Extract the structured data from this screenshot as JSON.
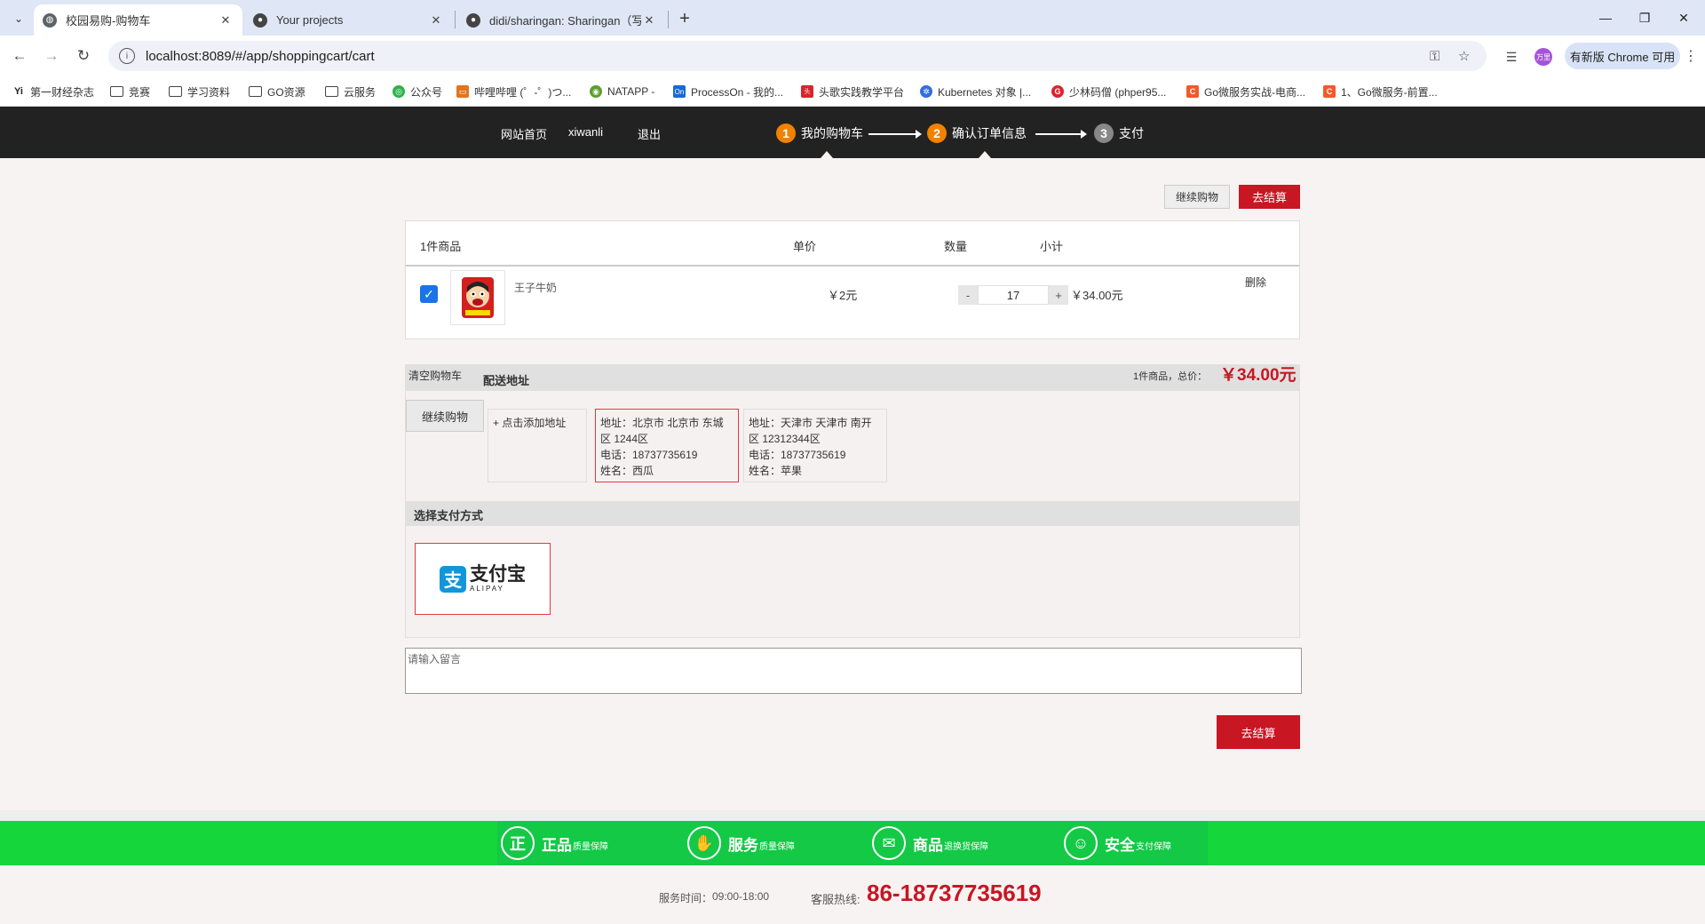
{
  "browser": {
    "tabs": [
      {
        "title": "校园易购-购物车",
        "active": true,
        "icon": "globe-icon"
      },
      {
        "title": "Your projects",
        "active": false,
        "icon": "github-icon"
      },
      {
        "title": "didi/sharingan: Sharingan（写",
        "active": false,
        "icon": "github-icon"
      }
    ],
    "url": "localhost:8089/#/app/shoppingcart/cart",
    "update_button": "有新版 Chrome 可用",
    "profile_label": "万里",
    "bookmarks": [
      {
        "label": "第一财经杂志",
        "icon": "yicai-icon",
        "color": "#222222"
      },
      {
        "label": "竞赛",
        "icon": "folder-icon",
        "color": ""
      },
      {
        "label": "学习资料",
        "icon": "folder-icon",
        "color": ""
      },
      {
        "label": "GO资源",
        "icon": "folder-icon",
        "color": ""
      },
      {
        "label": "云服务",
        "icon": "folder-icon",
        "color": ""
      },
      {
        "label": "公众号",
        "icon": "wechat-icon",
        "color": "#2db34a"
      },
      {
        "label": "哔哩哔哩 (゜-゜)つ...",
        "icon": "bilibili-icon",
        "color": "#e2741e"
      },
      {
        "label": "NATAPP -",
        "icon": "natapp-icon",
        "color": "#5aa02c"
      },
      {
        "label": "ProcessOn - 我的...",
        "icon": "processon-icon",
        "color": "#1769d3"
      },
      {
        "label": "头歌实践教学平台",
        "icon": "educoder-icon",
        "color": "#d9242c"
      },
      {
        "label": "Kubernetes 对象 |...",
        "icon": "kubernetes-icon",
        "color": "#326ce5"
      },
      {
        "label": "少林码僧 (phper95...",
        "icon": "shaolin-icon",
        "color": "#d9242c"
      },
      {
        "label": "Go微服务实战-电商...",
        "icon": "csdn-icon",
        "color": "#f25a29"
      },
      {
        "label": "1、Go微服务-前置...",
        "icon": "csdn-icon",
        "color": "#f25a29"
      }
    ]
  },
  "site_nav": {
    "home": "网站首页",
    "user": "xiwanli",
    "logout": "退出"
  },
  "steps": [
    {
      "num": "1",
      "label": "我的购物车",
      "color": "#f08200"
    },
    {
      "num": "2",
      "label": "确认订单信息",
      "color": "#f08200"
    },
    {
      "num": "3",
      "label": "支付",
      "color": "#888888"
    }
  ],
  "top_actions": {
    "continue": "继续购物",
    "checkout": "去结算"
  },
  "cart": {
    "headers": {
      "items": "1件商品",
      "price": "单价",
      "qty": "数量",
      "subtotal": "小计"
    },
    "rows": [
      {
        "checked": true,
        "name": "王子牛奶",
        "price": "￥2元",
        "qty_minus": "-",
        "qty": "17",
        "qty_plus": "+",
        "subtotal": "￥34.00元",
        "delete": "删除"
      }
    ]
  },
  "summary": {
    "clear": "清空购物车",
    "continue": "继续购物",
    "address_title": "配送地址",
    "count_text": "1件商品，总价：",
    "total": "￥34.00元"
  },
  "addresses": {
    "add": "+ 点击添加地址",
    "list": [
      {
        "line1": "地址：北京市 北京市 东城区 1244区",
        "phone": "电话：18737735619",
        "name": "姓名：西瓜",
        "selected": true
      },
      {
        "line1": "地址：天津市 天津市 南开区 12312344区",
        "phone": "电话：18737735619",
        "name": "姓名：苹果",
        "selected": false
      }
    ]
  },
  "payment": {
    "title": "选择支付方式",
    "alipay_cn": "支付宝",
    "alipay_en": "ALIPAY"
  },
  "memo": {
    "placeholder": "请输入留言"
  },
  "bottom_checkout": "去结算",
  "footer": {
    "promises": [
      {
        "icon": "zheng-icon",
        "glyph": "正",
        "main": "正品",
        "sub": "质量保障"
      },
      {
        "icon": "service-icon",
        "glyph": "✋",
        "main": "服务",
        "sub": "质量保障"
      },
      {
        "icon": "mail-icon",
        "glyph": "✉",
        "main": "商品",
        "sub": "退换货保障"
      },
      {
        "icon": "shield-user-icon",
        "glyph": "☺",
        "main": "安全",
        "sub": "支付保障"
      }
    ],
    "service_time_label": "服务时间：",
    "service_time": "09:00-18:00",
    "hotline_label": "客服热线:",
    "hotline": "86-18737735619"
  },
  "colors": {
    "accent_red": "#c81623",
    "step_orange": "#f08200",
    "footer_green": "#15d63b",
    "header_dark": "#222222"
  }
}
